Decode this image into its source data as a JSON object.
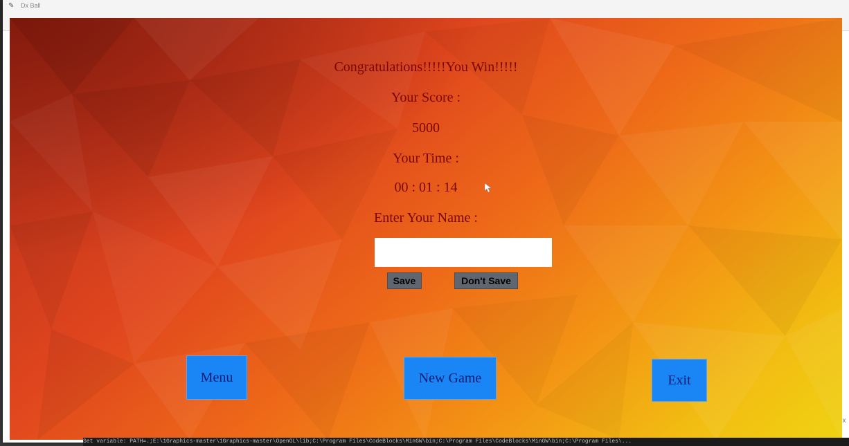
{
  "window": {
    "title": "Dx Ball",
    "minimize_glyph": "—",
    "maximize_glyph": "☐",
    "close_glyph": "✕"
  },
  "result": {
    "headline": "Congratulations!!!!!You Win!!!!!",
    "score_label": "Your Score :",
    "score_value": "5000",
    "time_label": "Your Time :",
    "time_value": "00 : 01 : 14",
    "name_label": "Enter Your Name :"
  },
  "name_input": {
    "value": "",
    "placeholder": ""
  },
  "buttons": {
    "save": "Save",
    "dont_save": "Don't Save",
    "menu": "Menu",
    "new_game": "New Game",
    "exit": "Exit"
  },
  "console": {
    "text": "Set variable: PATH=.;E:\\1Graphics-master\\1Graphics-master\\OpenGL\\lib;C:\\Program Files\\CodeBlocks\\MinGW\\bin;C:\\Program Files\\CodeBlocks\\MinGW\\bin;C:\\Program Files\\..."
  },
  "colors": {
    "text_dark_red": "#7a0606",
    "button_blue": "#1a86f5",
    "button_text_navy": "#0b1d78",
    "small_button_gray": "#5f6670",
    "background_red": "#c8381c",
    "background_yellow": "#f0d212"
  },
  "icons": {
    "app": "pencil-icon",
    "cursor": "mouse-pointer-icon"
  }
}
